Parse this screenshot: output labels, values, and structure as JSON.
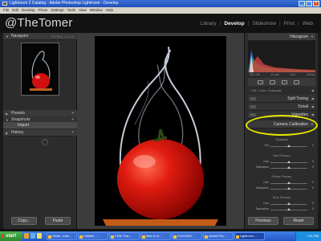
{
  "window": {
    "title": "Lightroom 2 Catalog - Adobe Photoshop Lightroom - Develop"
  },
  "menu": [
    "File",
    "Edit",
    "Develop",
    "Photo",
    "Settings",
    "Tools",
    "View",
    "Window",
    "Help"
  ],
  "identity": {
    "brand": "@TheTomer"
  },
  "modules": {
    "library": "Library",
    "develop": "Develop",
    "slideshow": "Slideshow",
    "print": "Print",
    "web": "Web"
  },
  "left_panel": {
    "navigator": "Navigator",
    "nav_zoom": "FIT  FILL  1:1  1:4",
    "presets": "Presets",
    "snapshots": "Snapshots",
    "snapshot_item": "Import",
    "history": "History",
    "copy": "Copy...",
    "paste": "Paste"
  },
  "right_panel": {
    "histogram": "Histogram",
    "readout": [
      "ISO 100",
      "11 mm",
      "f/4.0",
      "1/8 sec"
    ],
    "hsl_row": "HSL / Color / Grayscale",
    "split_toning": "Split Toning",
    "detail": "Detail",
    "vignettes": "Vignettes",
    "camera_calibration": "Camera Calibration",
    "groups": [
      {
        "label": "Shadows",
        "sliders": [
          {
            "name": "Tint",
            "value": 0
          }
        ]
      },
      {
        "label": "Red Primary",
        "sliders": [
          {
            "name": "Hue",
            "value": 0
          },
          {
            "name": "Saturation",
            "value": 0
          }
        ]
      },
      {
        "label": "Green Primary",
        "sliders": [
          {
            "name": "Hue",
            "value": 0
          },
          {
            "name": "Saturation",
            "value": 0
          }
        ]
      },
      {
        "label": "Blue Primary",
        "sliders": [
          {
            "name": "Hue",
            "value": 0
          },
          {
            "name": "Saturation",
            "value": 0
          }
        ]
      }
    ],
    "previous": "Previous",
    "reset": "Reset"
  },
  "taskbar": {
    "start": "start",
    "tasks": [
      "Gmail - Inbo...",
      "Untitled - ...",
      "CS3L Trac...",
      "New (1 of ...",
      "G:\\DCIM\\1...",
      "Adobe Pho...",
      "Lightroom ..."
    ],
    "clock": "7:41 PM"
  },
  "colors": {
    "highlight": "#e8e800",
    "tomato": "#d01010",
    "accent_blue": "#2458c8"
  }
}
